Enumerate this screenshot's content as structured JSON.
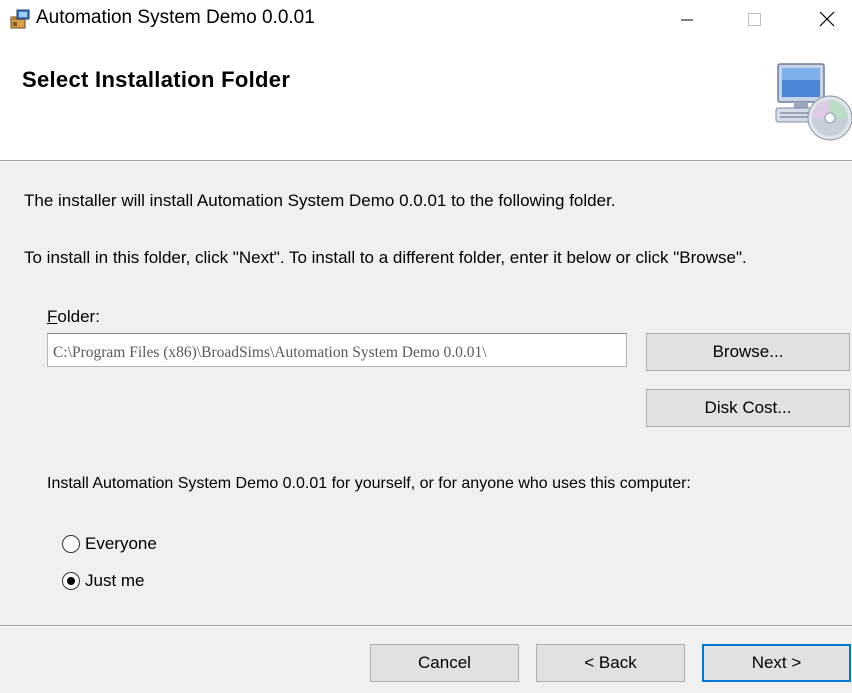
{
  "window": {
    "title": "Automation System Demo 0.0.01",
    "icon": "installer-app-icon"
  },
  "header": {
    "title": "Select Installation Folder",
    "icon": "computer-cd-icon"
  },
  "body": {
    "intro": "The installer will install Automation System Demo 0.0.01 to the following folder.",
    "instruction": "To install in this folder, click \"Next\". To install to a different folder, enter it below or click \"Browse\".",
    "folder_label_accel": "F",
    "folder_label_rest": "older:",
    "folder_value": "C:\\Program Files (x86)\\BroadSims\\Automation System Demo 0.0.01\\",
    "browse_label": "Browse...",
    "disk_cost_label": "Disk Cost...",
    "install_for": "Install Automation System Demo 0.0.01 for yourself, or for anyone who uses this computer:",
    "options": [
      {
        "label": "Everyone",
        "selected": false
      },
      {
        "label": "Just me",
        "selected": true
      }
    ]
  },
  "footer": {
    "cancel_label": "Cancel",
    "back_label": "< Back",
    "next_label": "Next >"
  },
  "colors": {
    "accent": "#0078d7",
    "background": "#f0f0f0",
    "header_background": "#ffffff"
  }
}
